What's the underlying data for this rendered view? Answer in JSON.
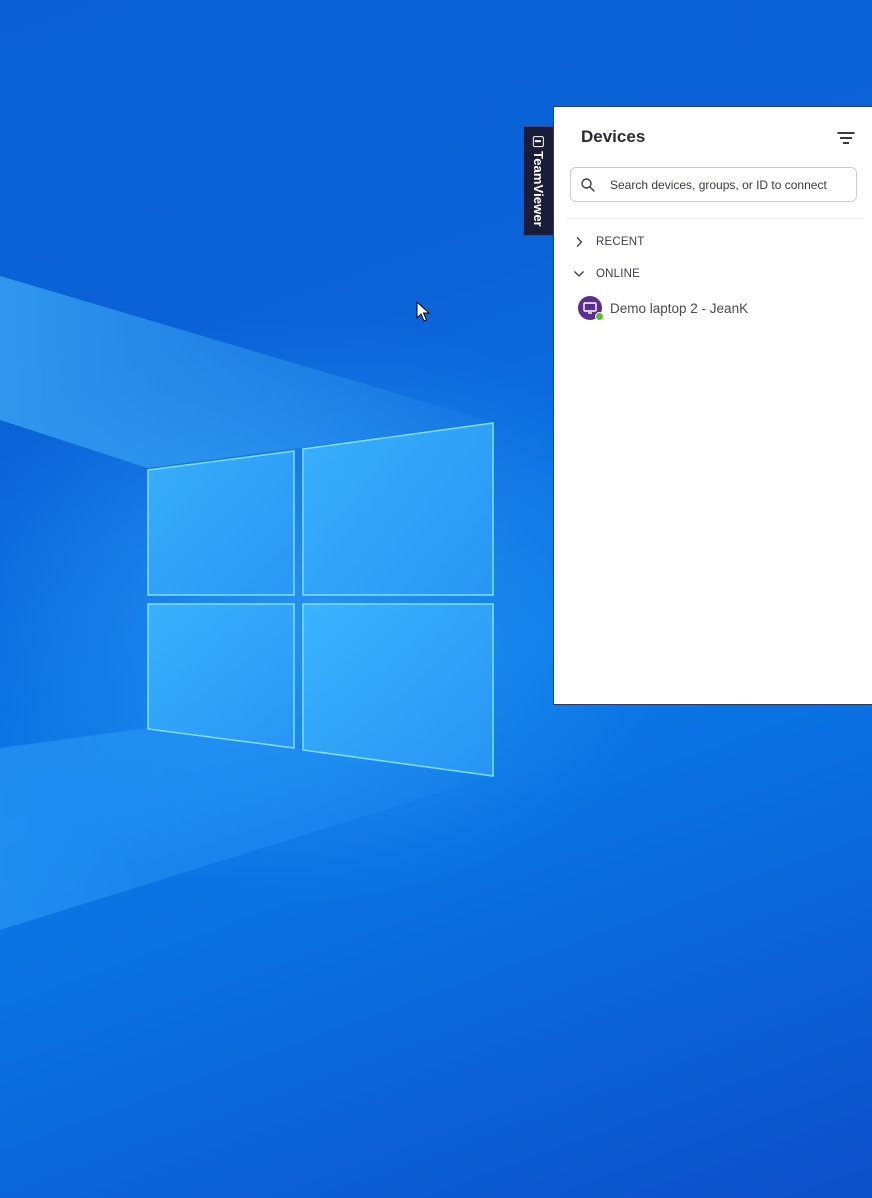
{
  "desktop": {
    "background_colors": [
      "#0a5fd6",
      "#0a79e6",
      "#0d4fc9"
    ],
    "logo_color": "#3bb4ff"
  },
  "sidebar_tab": {
    "brand": "TeamViewer",
    "icon": "teamviewer-logo-icon"
  },
  "devices_panel": {
    "title": "Devices",
    "filter_icon": "filter-icon",
    "search": {
      "placeholder": "Search devices, groups, or ID to connect",
      "value": "",
      "icon": "search-icon"
    },
    "sections": [
      {
        "label": "RECENT",
        "expanded": false,
        "icon": "chevron-right-icon"
      },
      {
        "label": "ONLINE",
        "expanded": true,
        "icon": "chevron-down-icon"
      }
    ],
    "devices": [
      {
        "name": "Demo laptop 2 - JeanK",
        "status": "online",
        "icon": "monitor-icon",
        "avatar_color": "#5d2e8c",
        "status_color": "#5bbf2a"
      }
    ]
  }
}
